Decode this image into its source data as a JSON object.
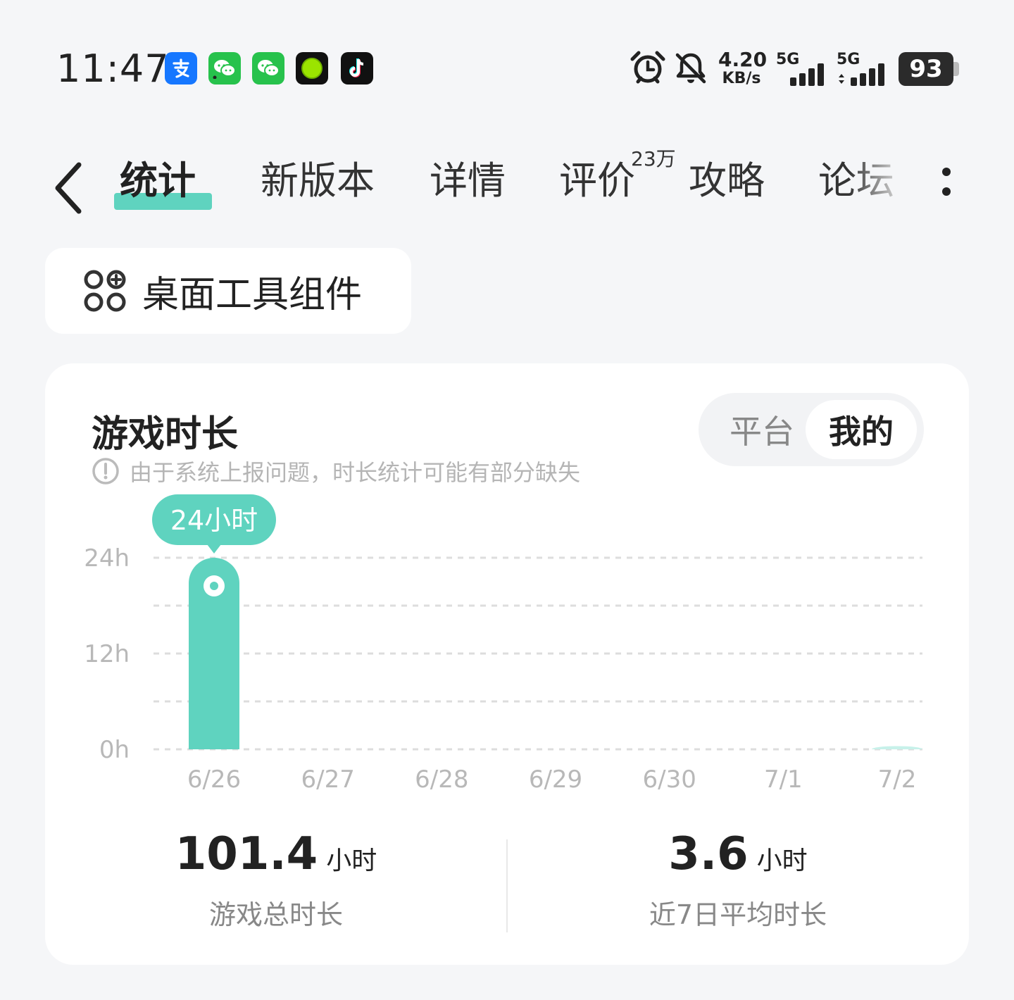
{
  "status_bar": {
    "time": "11:47",
    "net_speed_value": "4.20",
    "net_speed_unit": "KB/s",
    "signal1_label": "5G",
    "signal2_label": "5G",
    "battery": "93",
    "icons": [
      "alipay-icon",
      "wechat-icon",
      "wechat-icon",
      "green-dot-app-icon",
      "tiktok-icon",
      "alarm-icon",
      "mute-bell-icon"
    ]
  },
  "tabs": [
    {
      "label": "统计",
      "active": true
    },
    {
      "label": "新版本"
    },
    {
      "label": "详情"
    },
    {
      "label": "评价",
      "badge": "23万"
    },
    {
      "label": "攻略"
    },
    {
      "label": "论坛"
    }
  ],
  "widget_button": {
    "label": "桌面工具组件"
  },
  "card": {
    "title": "游戏时长",
    "notice": "由于系统上报问题，时长统计可能有部分缺失",
    "segment": {
      "platform": "平台",
      "mine": "我的",
      "selected": "mine"
    }
  },
  "chart_data": {
    "type": "bar",
    "categories": [
      "6/26",
      "6/27",
      "6/28",
      "6/29",
      "6/30",
      "7/1",
      "7/2"
    ],
    "values": [
      24,
      0,
      0,
      0,
      0,
      0,
      0.4
    ],
    "y_ticks": [
      "0h",
      "12h",
      "24h"
    ],
    "ylim": [
      0,
      24
    ],
    "grid": true,
    "tooltip": {
      "category": "6/26",
      "text": "24小时"
    },
    "colors": {
      "bar": "#5fd3bf",
      "bar_faint": "#c7f1ea",
      "grid": "#dddddd"
    }
  },
  "summary": {
    "total": {
      "value": "101.4",
      "unit": "小时",
      "label": "游戏总时长"
    },
    "avg": {
      "value": "3.6",
      "unit": "小时",
      "label": "近7日平均时长"
    }
  }
}
